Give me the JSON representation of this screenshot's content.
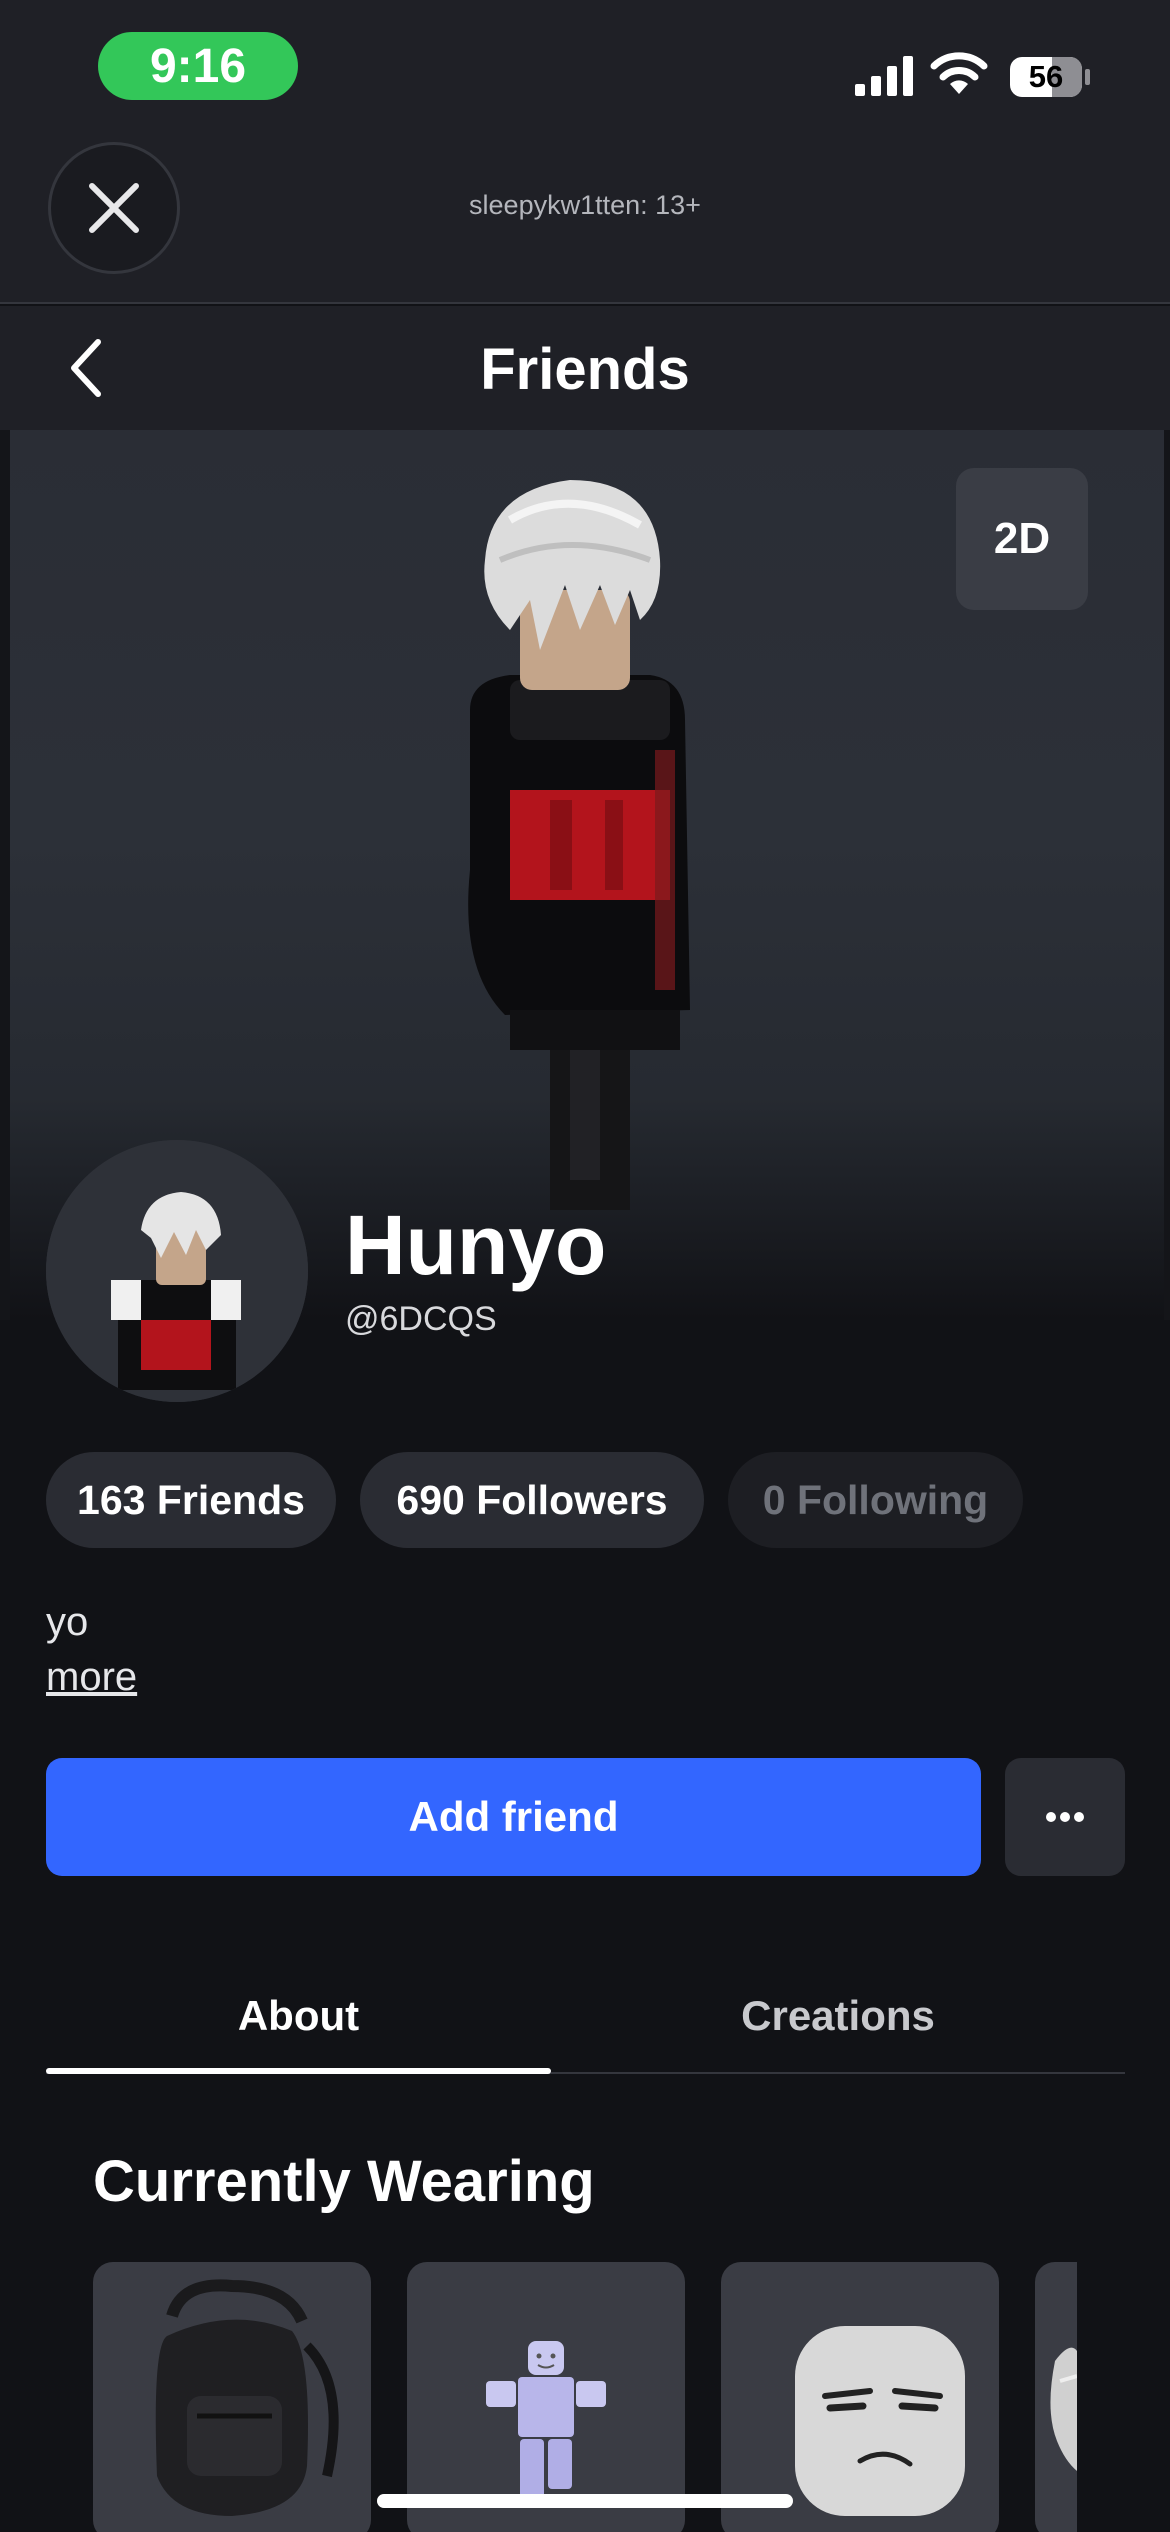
{
  "status_bar": {
    "time": "9:16",
    "battery": "56",
    "signal_icon": "cellular-signal-icon",
    "wifi_icon": "wifi-icon"
  },
  "top_bar": {
    "close_icon": "close-icon",
    "account_label": "sleepykw1tten: 13+"
  },
  "nav": {
    "back_icon": "chevron-left-icon",
    "title": "Friends"
  },
  "hero": {
    "view_toggle": "2D"
  },
  "profile": {
    "display_name": "Hunyo",
    "username": "@6DCQS",
    "bio": "yo",
    "more_label": "more"
  },
  "stats": [
    {
      "label": "163 Friends",
      "dim": false
    },
    {
      "label": "690 Followers",
      "dim": false
    },
    {
      "label": "0 Following",
      "dim": true
    }
  ],
  "actions": {
    "add_friend": "Add friend",
    "more_icon": "ellipsis-icon"
  },
  "tabs": [
    {
      "label": "About",
      "active": true
    },
    {
      "label": "Creations",
      "active": false
    }
  ],
  "wearing": {
    "title": "Currently Wearing",
    "items": [
      {
        "icon": "backpack-icon"
      },
      {
        "icon": "avatar-figure-icon"
      },
      {
        "icon": "face-icon"
      },
      {
        "icon": "hair-icon"
      }
    ]
  },
  "colors": {
    "accent": "#3366ff",
    "status_green": "#33c759",
    "background": "#111216",
    "surface": "#2a2c33"
  }
}
